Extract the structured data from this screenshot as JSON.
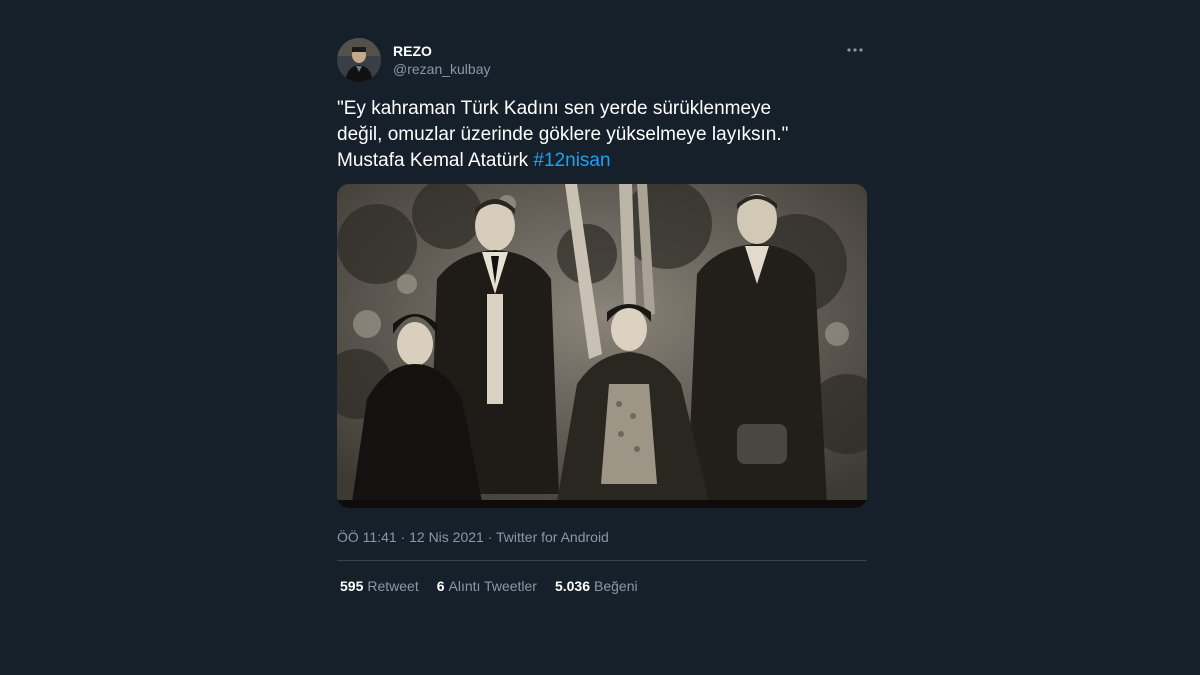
{
  "tweet": {
    "author": {
      "name": "REZO",
      "handle": "@rezan_kulbay"
    },
    "more_icon": "more-horizontal-icon",
    "text_main": "\"Ey kahraman Türk Kadını sen yerde sürüklenmeye\ndeğil, omuzlar üzerinde göklere yükselmeye layıksın.\"\nMustafa Kemal Atatürk ",
    "hashtag": "#12nisan",
    "meta": "ÖÖ 11:41 · 12 Nis 2021 · Twitter for Android",
    "stats": {
      "retweets_count": "595",
      "retweets_label": "Retweet",
      "quotes_count": "6",
      "quotes_label": "Alıntı Tweetler",
      "likes_count": "5.036",
      "likes_label": "Beğeni"
    }
  },
  "colors": {
    "background": "#15202b",
    "hashtag": "#1da1f2",
    "secondary_text": "#8899a6",
    "divider": "#38444d"
  }
}
